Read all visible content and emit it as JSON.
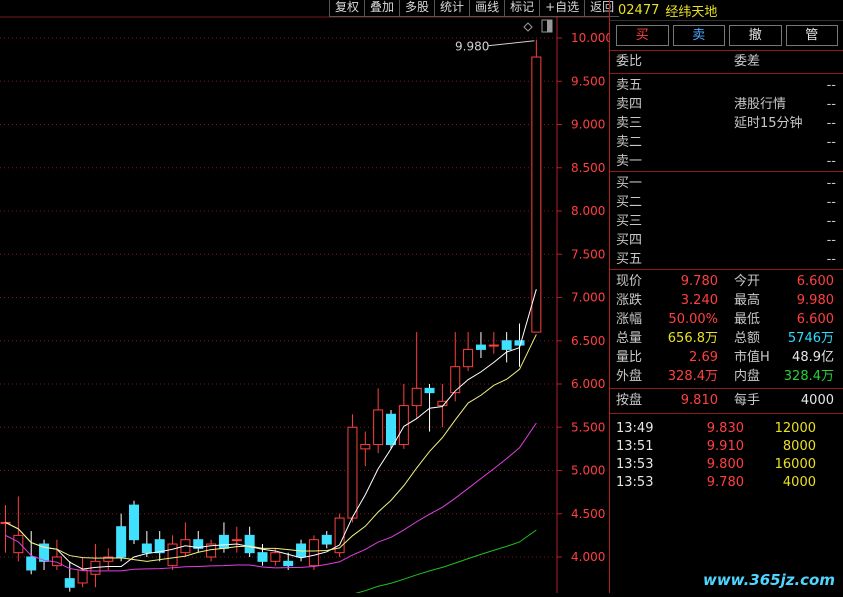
{
  "toolbar": [
    "复权",
    "叠加",
    "多股",
    "统计",
    "画线",
    "标记",
    "+自选",
    "返回"
  ],
  "stock": {
    "code": "02477",
    "name": "经纬天地"
  },
  "action_buttons": [
    "买",
    "卖",
    "撤",
    "管"
  ],
  "book_headers": {
    "left": "委比",
    "right": "委差"
  },
  "sell_levels": [
    {
      "label": "卖五",
      "note": "",
      "value": "--"
    },
    {
      "label": "卖四",
      "note": "港股行情",
      "value": "--"
    },
    {
      "label": "卖三",
      "note": "延时15分钟",
      "value": "--"
    },
    {
      "label": "卖二",
      "note": "",
      "value": "--"
    },
    {
      "label": "卖一",
      "note": "",
      "value": "--"
    }
  ],
  "buy_levels": [
    {
      "label": "买一",
      "value": "--"
    },
    {
      "label": "买二",
      "value": "--"
    },
    {
      "label": "买三",
      "value": "--"
    },
    {
      "label": "买四",
      "value": "--"
    },
    {
      "label": "买五",
      "value": "--"
    }
  ],
  "stats": [
    {
      "l1": "现价",
      "v1": "9.780",
      "c1": "red",
      "l2": "今开",
      "v2": "6.600",
      "c2": "red"
    },
    {
      "l1": "涨跌",
      "v1": "3.240",
      "c1": "red",
      "l2": "最高",
      "v2": "9.980",
      "c2": "red"
    },
    {
      "l1": "涨幅",
      "v1": "50.00%",
      "c1": "red",
      "l2": "最低",
      "v2": "6.600",
      "c2": "red"
    },
    {
      "l1": "总量",
      "v1": "656.8万",
      "c1": "yellow",
      "l2": "总额",
      "v2": "5746万",
      "c2": "cyan"
    },
    {
      "l1": "量比",
      "v1": "2.69",
      "c1": "red",
      "l2": "市值H",
      "v2": "48.9亿",
      "c2": "white"
    },
    {
      "l1": "外盘",
      "v1": "328.4万",
      "c1": "red",
      "l2": "内盘",
      "v2": "328.4万",
      "c2": "green"
    }
  ],
  "extra": {
    "l1": "按盘",
    "v1": "9.810",
    "l2": "每手",
    "v2": "4000"
  },
  "ticks": [
    {
      "time": "13:49",
      "price": "9.830",
      "vol": "12000"
    },
    {
      "time": "13:51",
      "price": "9.910",
      "vol": "8000"
    },
    {
      "time": "13:53",
      "price": "9.800",
      "vol": "16000"
    },
    {
      "time": "13:53",
      "price": "9.780",
      "vol": "4000"
    }
  ],
  "watermark": "www.365jz.com",
  "chart_data": {
    "type": "candlestick",
    "y_axis_labels": [
      "10.000",
      "9.500",
      "9.000",
      "8.500",
      "8.000",
      "7.500",
      "7.000",
      "6.500",
      "6.000",
      "5.500",
      "5.000",
      "4.500",
      "4.000"
    ],
    "ylim": [
      3.6,
      10.1
    ],
    "high_annotation": "9.980",
    "candles": [
      {
        "o": 4.4,
        "c": 4.4,
        "h": 4.6,
        "l": 4.05
      },
      {
        "o": 4.05,
        "c": 4.25,
        "h": 4.7,
        "l": 3.95
      },
      {
        "o": 4.0,
        "c": 3.85,
        "h": 4.3,
        "l": 3.8
      },
      {
        "o": 4.15,
        "c": 3.95,
        "h": 4.2,
        "l": 3.85
      },
      {
        "o": 3.9,
        "c": 4.0,
        "h": 4.2,
        "l": 3.85
      },
      {
        "o": 3.75,
        "c": 3.65,
        "h": 3.95,
        "l": 3.6
      },
      {
        "o": 3.7,
        "c": 3.85,
        "h": 4.0,
        "l": 3.65
      },
      {
        "o": 3.8,
        "c": 3.95,
        "h": 4.15,
        "l": 3.65
      },
      {
        "o": 3.95,
        "c": 4.0,
        "h": 4.1,
        "l": 3.85
      },
      {
        "o": 4.35,
        "c": 4.0,
        "h": 4.5,
        "l": 3.95
      },
      {
        "o": 4.6,
        "c": 4.2,
        "h": 4.65,
        "l": 4.15
      },
      {
        "o": 4.15,
        "c": 4.05,
        "h": 4.3,
        "l": 4.0
      },
      {
        "o": 4.2,
        "c": 4.05,
        "h": 4.3,
        "l": 3.95
      },
      {
        "o": 3.9,
        "c": 4.15,
        "h": 4.25,
        "l": 3.85
      },
      {
        "o": 4.05,
        "c": 4.2,
        "h": 4.4,
        "l": 4.0
      },
      {
        "o": 4.2,
        "c": 4.1,
        "h": 4.3,
        "l": 4.05
      },
      {
        "o": 4.0,
        "c": 4.15,
        "h": 4.2,
        "l": 3.95
      },
      {
        "o": 4.25,
        "c": 4.1,
        "h": 4.4,
        "l": 4.05
      },
      {
        "o": 4.2,
        "c": 4.2,
        "h": 4.35,
        "l": 4.05
      },
      {
        "o": 4.25,
        "c": 4.05,
        "h": 4.35,
        "l": 4.0
      },
      {
        "o": 4.05,
        "c": 3.95,
        "h": 4.15,
        "l": 3.9
      },
      {
        "o": 3.95,
        "c": 4.05,
        "h": 4.1,
        "l": 3.9
      },
      {
        "o": 3.95,
        "c": 3.9,
        "h": 4.05,
        "l": 3.85
      },
      {
        "o": 4.15,
        "c": 4.0,
        "h": 4.2,
        "l": 3.95
      },
      {
        "o": 3.9,
        "c": 4.2,
        "h": 4.25,
        "l": 3.85
      },
      {
        "o": 4.25,
        "c": 4.15,
        "h": 4.3,
        "l": 4.1
      },
      {
        "o": 4.05,
        "c": 4.45,
        "h": 4.5,
        "l": 4.0
      },
      {
        "o": 4.45,
        "c": 5.5,
        "h": 5.65,
        "l": 4.4
      },
      {
        "o": 5.25,
        "c": 5.3,
        "h": 5.45,
        "l": 5.05
      },
      {
        "o": 5.3,
        "c": 5.7,
        "h": 5.95,
        "l": 5.2
      },
      {
        "o": 5.65,
        "c": 5.3,
        "h": 5.7,
        "l": 5.25
      },
      {
        "o": 5.3,
        "c": 5.75,
        "h": 6.0,
        "l": 5.25
      },
      {
        "o": 5.75,
        "c": 5.95,
        "h": 6.6,
        "l": 5.6
      },
      {
        "o": 5.95,
        "c": 5.9,
        "h": 6.0,
        "l": 5.45
      },
      {
        "o": 5.75,
        "c": 5.8,
        "h": 6.0,
        "l": 5.5
      },
      {
        "o": 5.9,
        "c": 6.2,
        "h": 6.6,
        "l": 5.8
      },
      {
        "o": 6.2,
        "c": 6.4,
        "h": 6.6,
        "l": 6.15
      },
      {
        "o": 6.45,
        "c": 6.4,
        "h": 6.6,
        "l": 6.3
      },
      {
        "o": 6.45,
        "c": 6.45,
        "h": 6.6,
        "l": 6.35
      },
      {
        "o": 6.5,
        "c": 6.4,
        "h": 6.6,
        "l": 6.25
      },
      {
        "o": 6.5,
        "c": 6.45,
        "h": 6.7,
        "l": 6.2
      },
      {
        "o": 6.6,
        "c": 9.78,
        "h": 9.98,
        "l": 6.6
      }
    ]
  }
}
